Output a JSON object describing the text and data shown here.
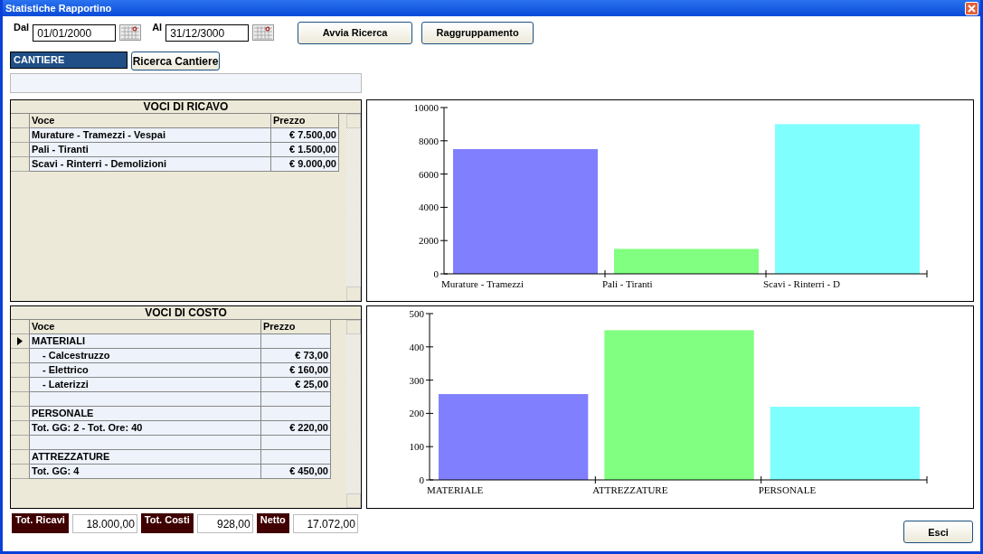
{
  "window": {
    "title": "Statistiche Rapportino"
  },
  "filters": {
    "from_label": "Dal",
    "from_value": "01/01/2000",
    "to_label": "Al",
    "to_value": "31/12/3000"
  },
  "buttons": [
    "Avvia Ricerca",
    "Raggruppamento"
  ],
  "cantiere": {
    "label": "CANTIERE",
    "button": "Ricerca Cantiere"
  },
  "ricavi": {
    "title": "VOCI DI RICAVO",
    "columns": [
      "Voce",
      "Prezzo"
    ],
    "rows": [
      {
        "selected": false,
        "voce": "Murature - Tramezzi - Vespai",
        "prezzo": "€ 7.500,00"
      },
      {
        "selected": false,
        "voce": "Pali - Tiranti",
        "prezzo": "€ 1.500,00"
      },
      {
        "selected": false,
        "voce": "Scavi - Rinterri - Demolizioni",
        "prezzo": "€ 9.000,00"
      }
    ]
  },
  "costi": {
    "title": "VOCI DI COSTO",
    "columns": [
      "Voce",
      "Prezzo"
    ],
    "rows": [
      {
        "kind": "item",
        "selected": true,
        "voce": "MATERIALI"
      },
      {
        "kind": "sub",
        "selected": false,
        "voce": "- Calcestruzzo",
        "prezzo": "€ 73,00"
      },
      {
        "kind": "sub",
        "selected": false,
        "voce": "- Elettrico",
        "prezzo": "€ 160,00"
      },
      {
        "kind": "sub",
        "selected": false,
        "voce": "- Laterizzi",
        "prezzo": "€ 25,00"
      },
      {
        "kind": "item",
        "selected": false
      },
      {
        "kind": "item",
        "selected": false,
        "voce": "PERSONALE"
      },
      {
        "kind": "item",
        "selected": false,
        "voce": "Tot. GG: 2 - Tot. Ore: 40",
        "prezzo": "€ 220,00"
      },
      {
        "kind": "item",
        "selected": false
      },
      {
        "kind": "item",
        "selected": false,
        "voce": "ATTREZZATURE"
      },
      {
        "kind": "item",
        "selected": false,
        "voce": "Tot. GG: 4",
        "prezzo": "€ 450,00"
      }
    ]
  },
  "chart_ricavi": {
    "chart_data": {
      "type": "bar",
      "categories": [
        "Murature - Tramezzi",
        "Pali - Tiranti",
        "Scavi - Rinterri - D"
      ],
      "ylim": [
        0,
        10000
      ],
      "yticks": [
        0,
        2000,
        4000,
        6000,
        8000,
        10000
      ],
      "series": [
        {
          "color": "#8080ff",
          "values": [
            7500,
            null,
            null
          ]
        },
        {
          "color": "#80ff80",
          "values": [
            null,
            1500,
            null
          ]
        },
        {
          "color": "#80ffff",
          "values": [
            null,
            null,
            9000
          ]
        }
      ]
    }
  },
  "chart_costi": {
    "chart_data": {
      "type": "bar",
      "categories": [
        "MATERIALE",
        "ATTREZZATURE",
        "PERSONALE"
      ],
      "ylim": [
        0,
        500
      ],
      "yticks": [
        0,
        100,
        200,
        300,
        400,
        500
      ],
      "series": [
        {
          "color": "#8080ff",
          "values": [
            258,
            null,
            null
          ]
        },
        {
          "color": "#80ff80",
          "values": [
            null,
            450,
            null
          ]
        },
        {
          "color": "#80ffff",
          "values": [
            null,
            null,
            220
          ]
        }
      ]
    }
  },
  "totals": [
    {
      "label": "Tot. Ricavi",
      "value": "18.000,00"
    },
    {
      "label": "Tot. Costi",
      "value": "928,00"
    },
    {
      "label": "Netto",
      "value": "17.072,00"
    }
  ],
  "exit_button": "Esci"
}
